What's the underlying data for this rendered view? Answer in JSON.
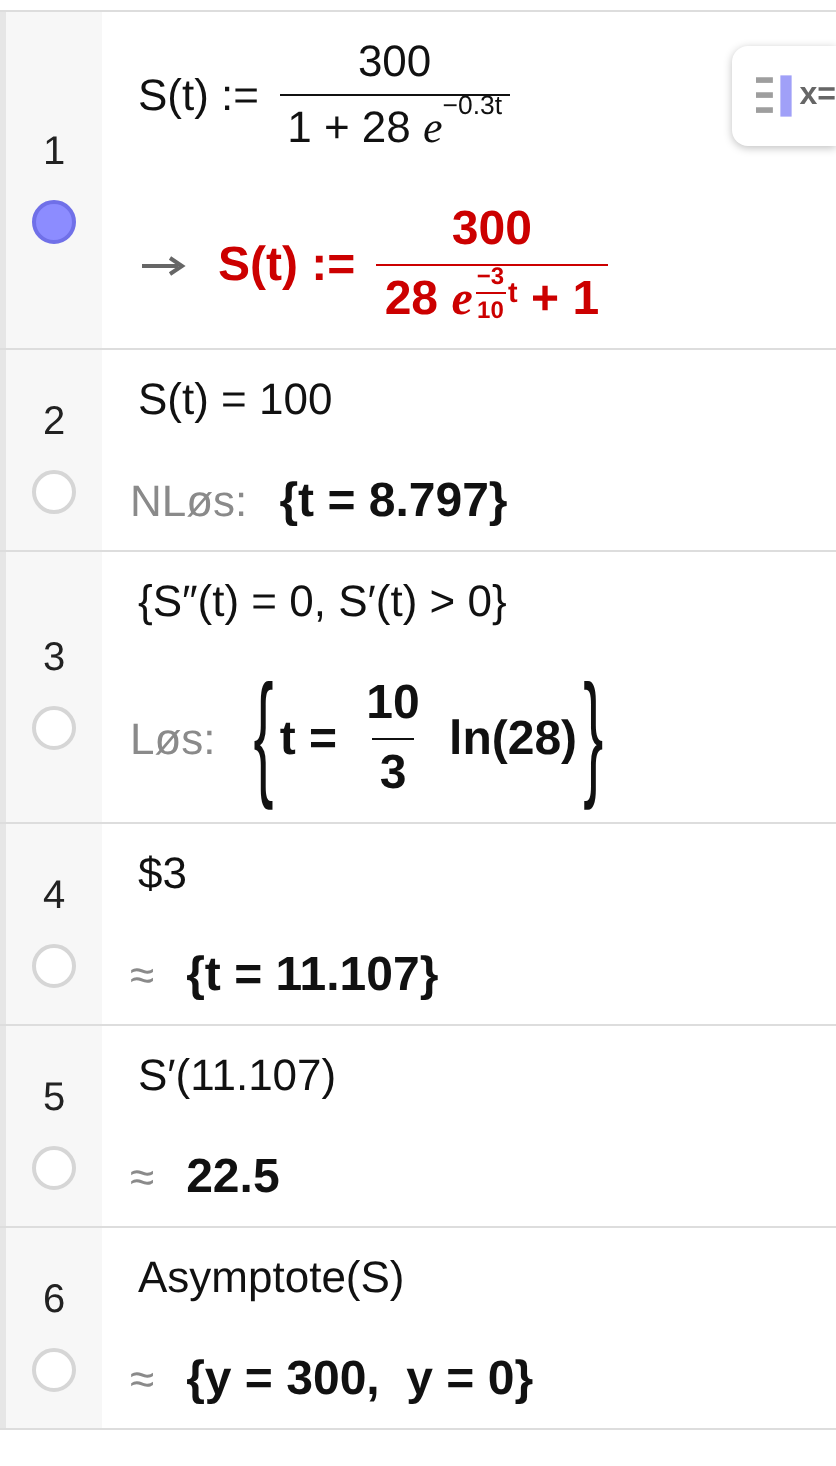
{
  "toolbar": {
    "label": "x="
  },
  "rows": [
    {
      "number": "1",
      "selected": true,
      "input": [
        "S(t) := ",
        {
          "kind": "frac",
          "num": [
            "300"
          ],
          "den": [
            "1 + 28 ",
            {
              "kind": "sup",
              "base": "e",
              "exp": [
                "−0.3t"
              ]
            }
          ]
        }
      ],
      "prefix": {
        "kind": "arrow"
      },
      "highlighted": true,
      "output": [
        "S(t) := ",
        {
          "kind": "frac",
          "num": [
            "300"
          ],
          "den": [
            "28 ",
            {
              "kind": "sup",
              "base": "e",
              "exp": [
                {
                  "kind": "frac",
                  "num": [
                    "−3"
                  ],
                  "den": [
                    "10"
                  ]
                },
                "t"
              ]
            },
            " + 1"
          ]
        }
      ]
    },
    {
      "number": "2",
      "selected": false,
      "input": [
        "S(t) = 100"
      ],
      "prefix": {
        "kind": "label",
        "text": "NLøs:"
      },
      "highlighted": false,
      "output": [
        "{t = 8.797}"
      ]
    },
    {
      "number": "3",
      "selected": false,
      "input": [
        "{S″(t) = 0, S′(t) > 0}"
      ],
      "prefix": {
        "kind": "label",
        "text": "Løs:"
      },
      "highlighted": false,
      "output": [
        {
          "kind": "brace",
          "open": "{",
          "close": "}",
          "items": [
            "t = ",
            {
              "kind": "frac",
              "num": [
                "10"
              ],
              "den": [
                "3"
              ]
            },
            " ln(28)"
          ]
        }
      ]
    },
    {
      "number": "4",
      "selected": false,
      "input": [
        "$3"
      ],
      "prefix": {
        "kind": "label",
        "text": "≈"
      },
      "highlighted": false,
      "output": [
        "{t = 11.107}"
      ]
    },
    {
      "number": "5",
      "selected": false,
      "input": [
        "S′(11.107)"
      ],
      "prefix": {
        "kind": "label",
        "text": "≈"
      },
      "highlighted": false,
      "output": [
        "22.5"
      ]
    },
    {
      "number": "6",
      "selected": false,
      "input": [
        "Asymptote(S)"
      ],
      "prefix": {
        "kind": "label",
        "text": "≈"
      },
      "highlighted": false,
      "output": [
        "{y = 300,  y = 0}"
      ]
    }
  ]
}
